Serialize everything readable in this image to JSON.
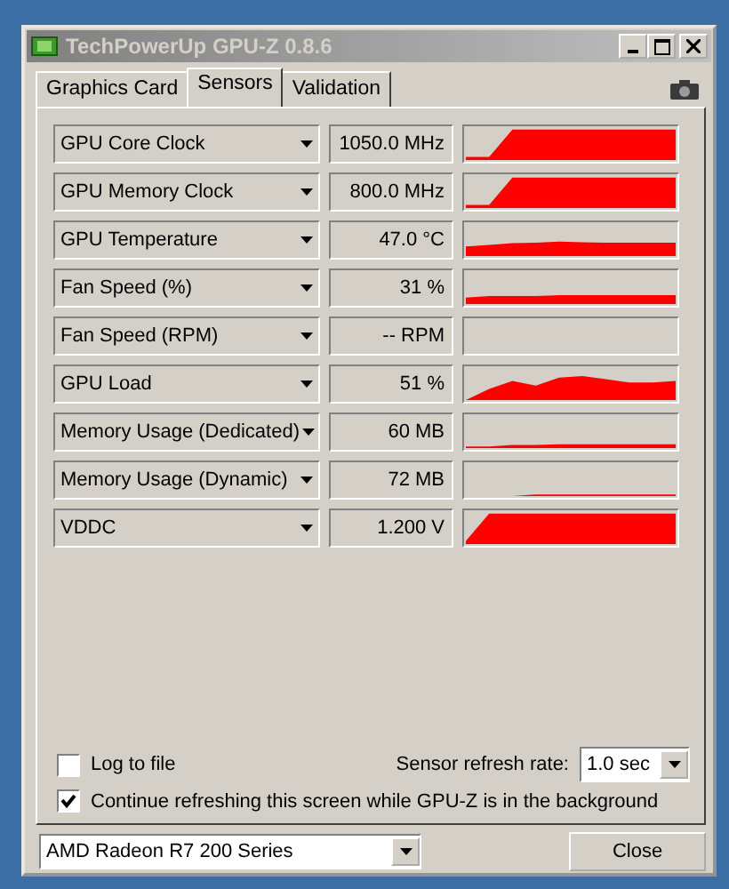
{
  "window": {
    "title": "TechPowerUp GPU-Z 0.8.6"
  },
  "tabs": [
    {
      "label": "Graphics Card",
      "selected": false
    },
    {
      "label": "Sensors",
      "selected": true
    },
    {
      "label": "Validation",
      "selected": false
    }
  ],
  "sensors": [
    {
      "name": "GPU Core Clock",
      "reading": "1050.0 MHz"
    },
    {
      "name": "GPU Memory Clock",
      "reading": "800.0 MHz"
    },
    {
      "name": "GPU Temperature",
      "reading": "47.0 °C"
    },
    {
      "name": "Fan Speed (%)",
      "reading": "31 %"
    },
    {
      "name": "Fan Speed (RPM)",
      "reading": "-- RPM"
    },
    {
      "name": "GPU Load",
      "reading": "51 %"
    },
    {
      "name": "Memory Usage (Dedicated)",
      "reading": "60 MB"
    },
    {
      "name": "Memory Usage (Dynamic)",
      "reading": "72 MB"
    },
    {
      "name": "VDDC",
      "reading": "1.200 V"
    }
  ],
  "options": [
    {
      "label": "Log to file",
      "checked": false
    },
    {
      "label": "Continue refreshing this screen while GPU-Z is in the background",
      "checked": true
    }
  ],
  "refresh_rate": {
    "label": "Sensor refresh rate:",
    "value": "1.0 sec"
  },
  "card_select": {
    "value": "AMD Radeon R7 200 Series"
  },
  "buttons": [
    "Close"
  ]
}
